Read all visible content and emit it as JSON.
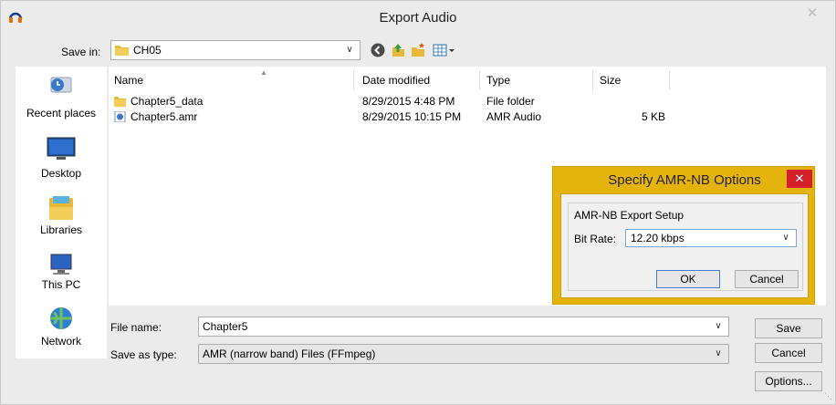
{
  "window": {
    "title": "Export Audio",
    "close_glyph": "✕"
  },
  "save_in": {
    "label": "Save in:",
    "value": "CH05"
  },
  "toolbar_icons": [
    "back-icon",
    "up-folder-icon",
    "new-folder-icon",
    "view-menu-icon"
  ],
  "places": [
    {
      "label": "Recent places",
      "icon": "recent-places-icon"
    },
    {
      "label": "Desktop",
      "icon": "desktop-icon"
    },
    {
      "label": "Libraries",
      "icon": "libraries-icon"
    },
    {
      "label": "This PC",
      "icon": "this-pc-icon"
    },
    {
      "label": "Network",
      "icon": "network-icon"
    }
  ],
  "columns": [
    "Name",
    "Date modified",
    "Type",
    "Size"
  ],
  "files": [
    {
      "name": "Chapter5_data",
      "date": "8/29/2015 4:48 PM",
      "type": "File folder",
      "size": "",
      "icon": "folder-icon"
    },
    {
      "name": "Chapter5.amr",
      "date": "8/29/2015 10:15 PM",
      "type": "AMR Audio",
      "size": "5 KB",
      "icon": "audio-file-icon"
    }
  ],
  "file_name": {
    "label": "File name:",
    "value": "Chapter5"
  },
  "save_as_type": {
    "label": "Save as type:",
    "value": "AMR (narrow band) Files (FFmpeg)"
  },
  "buttons": {
    "save": "Save",
    "cancel": "Cancel",
    "options": "Options..."
  },
  "amr_dialog": {
    "title": "Specify AMR-NB Options",
    "close_glyph": "✕",
    "group_label": "AMR-NB Export Setup",
    "bit_rate_label": "Bit Rate:",
    "bit_rate_value": "12.20 kbps",
    "ok": "OK",
    "cancel": "Cancel"
  },
  "colors": {
    "dialog_accent": "#e5b40c",
    "close_red": "#d4202a",
    "folder": "#e8b838"
  }
}
